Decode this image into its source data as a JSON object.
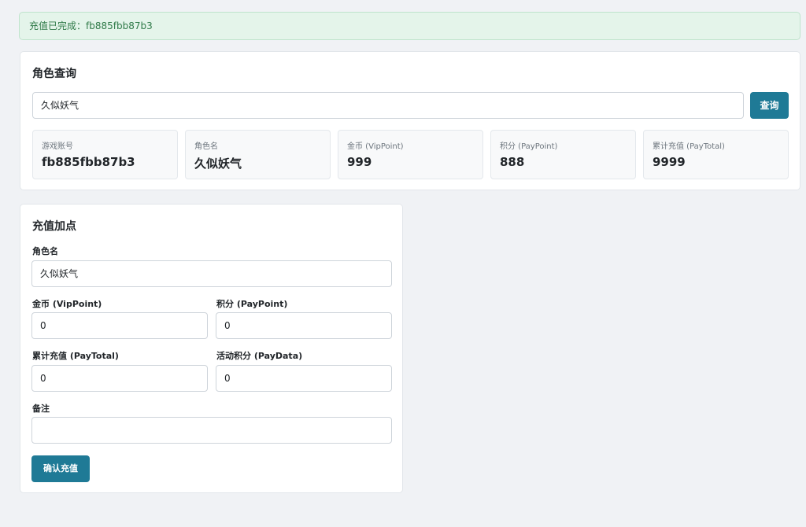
{
  "alert": {
    "text": "充值已完成：fb885fbb87b3"
  },
  "query": {
    "title": "角色查询",
    "input_value": "久似妖气",
    "button_label": "查询",
    "stats": [
      {
        "label": "游戏账号",
        "value": "fb885fbb87b3"
      },
      {
        "label": "角色名",
        "value": "久似妖气"
      },
      {
        "label": "金币 (VipPoint)",
        "value": "999"
      },
      {
        "label": "积分 (PayPoint)",
        "value": "888"
      },
      {
        "label": "累计充值 (PayTotal)",
        "value": "9999"
      }
    ]
  },
  "recharge": {
    "title": "充值加点",
    "role_label": "角色名",
    "role_value": "久似妖气",
    "vip_label": "金币 (VipPoint)",
    "vip_value": "0",
    "pay_point_label": "积分 (PayPoint)",
    "pay_point_value": "0",
    "pay_total_label": "累计充值 (PayTotal)",
    "pay_total_value": "0",
    "pay_data_label": "活动积分 (PayData)",
    "pay_data_value": "0",
    "note_label": "备注",
    "note_value": "",
    "confirm_label": "确认充值"
  },
  "colors": {
    "accent": "#1f7a96",
    "success_bg": "#e4f4ea",
    "success_text": "#2f7a48",
    "page_bg": "#f0f2f5"
  }
}
